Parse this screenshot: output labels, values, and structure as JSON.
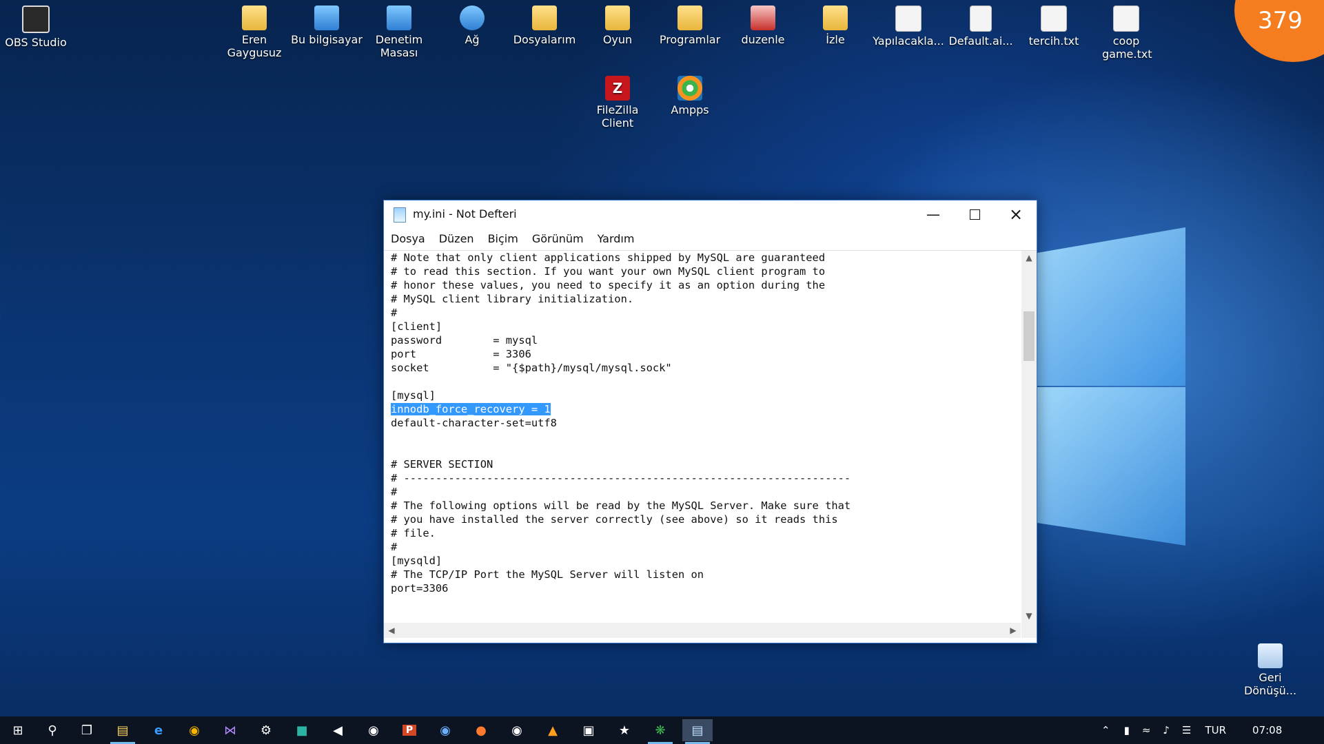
{
  "badge": "379",
  "desktop": {
    "icons": [
      {
        "id": "obs",
        "label": "OBS Studio",
        "icon": "obs-icon"
      },
      {
        "id": "user",
        "label": "Eren Gaygusuz",
        "icon": "user-folder-icon"
      },
      {
        "id": "pc",
        "label": "Bu bilgisayar",
        "icon": "computer-icon"
      },
      {
        "id": "control",
        "label": "Denetim Masası",
        "icon": "control-panel-icon"
      },
      {
        "id": "network",
        "label": "Ağ",
        "icon": "network-icon"
      },
      {
        "id": "docs",
        "label": "Dosyalarım",
        "icon": "folder-icon"
      },
      {
        "id": "game",
        "label": "Oyun",
        "icon": "folder-icon"
      },
      {
        "id": "programs",
        "label": "Programlar",
        "icon": "folder-icon"
      },
      {
        "id": "duzenle",
        "label": "duzenle",
        "icon": "archive-icon"
      },
      {
        "id": "izle",
        "label": "İzle",
        "icon": "folder-icon"
      },
      {
        "id": "todo",
        "label": "Yapılacakla...",
        "icon": "text-file-icon"
      },
      {
        "id": "default",
        "label": "Default.ai...",
        "icon": "file-icon"
      },
      {
        "id": "tercih",
        "label": "tercih.txt",
        "icon": "text-file-icon"
      },
      {
        "id": "coop",
        "label": "coop game.txt",
        "icon": "text-file-icon"
      },
      {
        "id": "filezilla",
        "label": "FileZilla Client",
        "icon": "filezilla-icon"
      },
      {
        "id": "ampps",
        "label": "Ampps",
        "icon": "ampps-icon"
      },
      {
        "id": "recycle",
        "label": "Geri Dönüşü...",
        "icon": "recycle-bin-icon"
      }
    ]
  },
  "notepad": {
    "title": "my.ini - Not Defteri",
    "menu": [
      "Dosya",
      "Düzen",
      "Biçim",
      "Görünüm",
      "Yardım"
    ],
    "lines": [
      "# Note that only client applications shipped by MySQL are guaranteed",
      "# to read this section. If you want your own MySQL client program to",
      "# honor these values, you need to specify it as an option during the",
      "# MySQL client library initialization.",
      "#",
      "[client]",
      "password        = mysql",
      "port            = 3306",
      "socket          = \"{$path}/mysql/mysql.sock\"",
      "",
      "[mysql]",
      "innodb_force_recovery = 1",
      "default-character-set=utf8",
      "",
      "",
      "# SERVER SECTION",
      "# ----------------------------------------------------------------------",
      "#",
      "# The following options will be read by the MySQL Server. Make sure that",
      "# you have installed the server correctly (see above) so it reads this",
      "# file.",
      "#",
      "[mysqld]",
      "# The TCP/IP Port the MySQL Server will listen on",
      "port=3306"
    ],
    "selected_line": 11
  },
  "taskbar": {
    "language": "TUR",
    "time": "07:08"
  }
}
